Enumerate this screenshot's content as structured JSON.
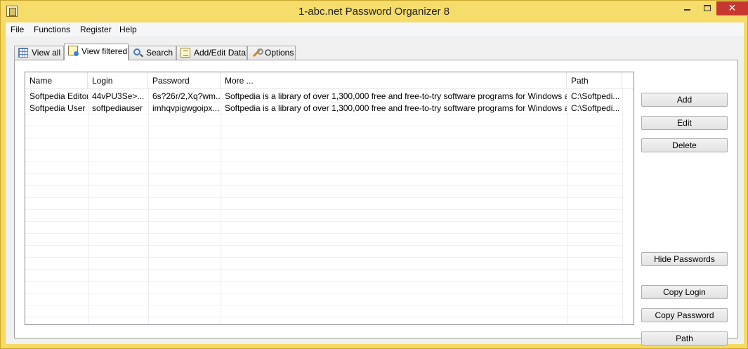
{
  "window": {
    "title": "1-abc.net Password Organizer 8",
    "close_glyph": "✕"
  },
  "menu": {
    "items": [
      "File",
      "Functions",
      "Register",
      "Help"
    ]
  },
  "tabs": [
    {
      "label": "View all",
      "icon": "grid-icon",
      "active": false
    },
    {
      "label": "View filtered",
      "icon": "filter-icon",
      "active": true
    },
    {
      "label": "Search",
      "icon": "magnifier-icon",
      "active": false
    },
    {
      "label": "Add/Edit Data",
      "icon": "edit-icon",
      "active": false
    },
    {
      "label": "Options",
      "icon": "wrench-icon",
      "active": false
    }
  ],
  "table": {
    "columns": [
      "Name",
      "Login",
      "Password",
      "More ...",
      "Path"
    ],
    "rows": [
      {
        "name": "Softpedia Editor",
        "login": "44vPU3Se>...",
        "password": "6s?26r/2,Xq?wm...",
        "more": "Softpedia is a library of over 1,300,000 free and free-to-try software programs for Windows and ...",
        "path": "C:\\Softpedi..."
      },
      {
        "name": "Softpedia User",
        "login": "softpediauser",
        "password": "imhqvpigwgoipx...",
        "more": "Softpedia is a library of over 1,300,000 free and free-to-try software programs for Windows and ...",
        "path": "C:\\Softpedi..."
      }
    ]
  },
  "buttons": {
    "add": "Add",
    "edit": "Edit",
    "delete": "Delete",
    "hide_passwords": "Hide Passwords",
    "copy_login": "Copy Login",
    "copy_password": "Copy Password",
    "path": "Path"
  },
  "colors": {
    "title_bar": "#f6dc6a",
    "close_button": "#c7372f"
  }
}
